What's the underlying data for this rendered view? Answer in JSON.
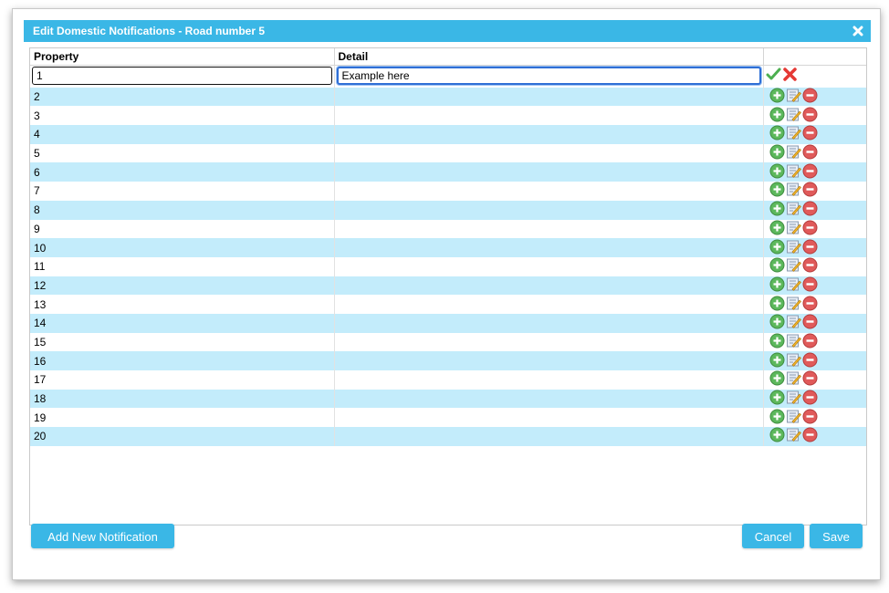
{
  "dialog": {
    "title": "Edit Domestic Notifications - Road number 5",
    "close_icon": "close-icon"
  },
  "table": {
    "headers": [
      "Property",
      "Detail",
      ""
    ],
    "edit_row": {
      "property_value": "1",
      "detail_value": "Example here",
      "confirm_icon": "checkmark-icon",
      "cancel_icon": "cross-icon"
    },
    "rows": [
      {
        "property": "2",
        "detail": ""
      },
      {
        "property": "3",
        "detail": ""
      },
      {
        "property": "4",
        "detail": ""
      },
      {
        "property": "5",
        "detail": ""
      },
      {
        "property": "6",
        "detail": ""
      },
      {
        "property": "7",
        "detail": ""
      },
      {
        "property": "8",
        "detail": ""
      },
      {
        "property": "9",
        "detail": ""
      },
      {
        "property": "10",
        "detail": ""
      },
      {
        "property": "11",
        "detail": ""
      },
      {
        "property": "12",
        "detail": ""
      },
      {
        "property": "13",
        "detail": ""
      },
      {
        "property": "14",
        "detail": ""
      },
      {
        "property": "15",
        "detail": ""
      },
      {
        "property": "16",
        "detail": ""
      },
      {
        "property": "17",
        "detail": ""
      },
      {
        "property": "18",
        "detail": ""
      },
      {
        "property": "19",
        "detail": ""
      },
      {
        "property": "20",
        "detail": ""
      }
    ],
    "row_action_icons": [
      "add-circle-icon",
      "edit-note-icon",
      "remove-circle-icon"
    ]
  },
  "footer": {
    "add_label": "Add New Notification",
    "cancel_label": "Cancel",
    "save_label": "Save"
  },
  "colors": {
    "accent": "#3ab7e6",
    "alt_row": "#c3ecfb",
    "add_green": "#5cb85c",
    "remove_red": "#e05a5a"
  }
}
